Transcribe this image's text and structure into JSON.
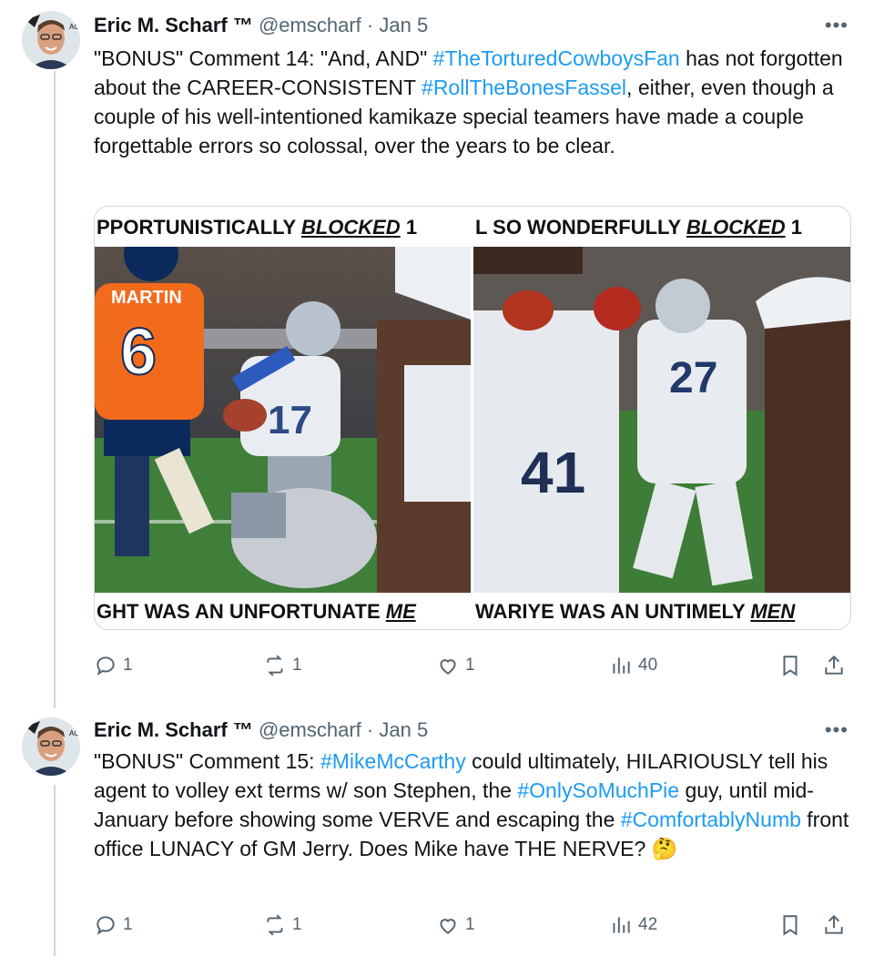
{
  "tweets": [
    {
      "author_name": "Eric M. Scharf ™",
      "handle": "@emscharf",
      "separator": "·",
      "date": "Jan 5",
      "more_label": "•••",
      "text_parts": [
        {
          "t": "\"BONUS\" Comment 14: \"And, AND\" ",
          "tag": false
        },
        {
          "t": "#TheTorturedCowboysFan",
          "tag": true
        },
        {
          "t": " has not forgotten about the CAREER-CONSISTENT ",
          "tag": false
        },
        {
          "t": "#RollTheBonesFassel",
          "tag": true
        },
        {
          "t": ", either, even though a couple of his well-intentioned kamikaze special teamers have made a couple forgettable errors so colossal, over the years to be clear.",
          "tag": false
        }
      ],
      "media": {
        "top_caption_left": "PPORTUNISTICALLY ",
        "top_caption_left_em": "BLOCKED",
        "top_caption_left_tail": " 1",
        "top_caption_right": "L SO WONDERFULLY ",
        "top_caption_right_em": "BLOCKED",
        "top_caption_right_tail": " 1",
        "bottom_caption_left": "GHT WAS AN UNFORTUNATE ",
        "bottom_caption_left_em": "ME",
        "bottom_caption_right": "WARIYE WAS AN UNTIMELY ",
        "bottom_caption_right_em": "MEN",
        "jersey_left_name": "MARTIN",
        "jersey_left_number": "6",
        "jersey_mid_number": "17",
        "jersey_right_number": "41",
        "jersey_far_number": "27"
      },
      "stats": {
        "replies": "1",
        "retweets": "1",
        "likes": "1",
        "views": "40"
      }
    },
    {
      "author_name": "Eric M. Scharf ™",
      "handle": "@emscharf",
      "separator": "·",
      "date": "Jan 5",
      "more_label": "•••",
      "text_parts": [
        {
          "t": "\"BONUS\" Comment 15: ",
          "tag": false
        },
        {
          "t": "#MikeMcCarthy",
          "tag": true
        },
        {
          "t": " could ultimately, HILARIOUSLY tell his agent to volley ext terms w/ son Stephen, the ",
          "tag": false
        },
        {
          "t": "#OnlySoMuchPie",
          "tag": true
        },
        {
          "t": " guy, until mid-January before showing some VERVE and escaping the ",
          "tag": false
        },
        {
          "t": "#ComfortablyNumb",
          "tag": true
        },
        {
          "t": " front office LUNACY of GM Jerry. Does Mike have THE NERVE? 🤔",
          "tag": false
        }
      ],
      "stats": {
        "replies": "1",
        "retweets": "1",
        "likes": "1",
        "views": "42"
      }
    }
  ],
  "icons": [
    "reply-icon",
    "retweet-icon",
    "like-icon",
    "views-icon",
    "bookmark-icon",
    "share-icon"
  ],
  "colors": {
    "hashtag": "#1d9bf0",
    "muted": "#536471",
    "text": "#0f1419",
    "border": "#cfd9de"
  }
}
